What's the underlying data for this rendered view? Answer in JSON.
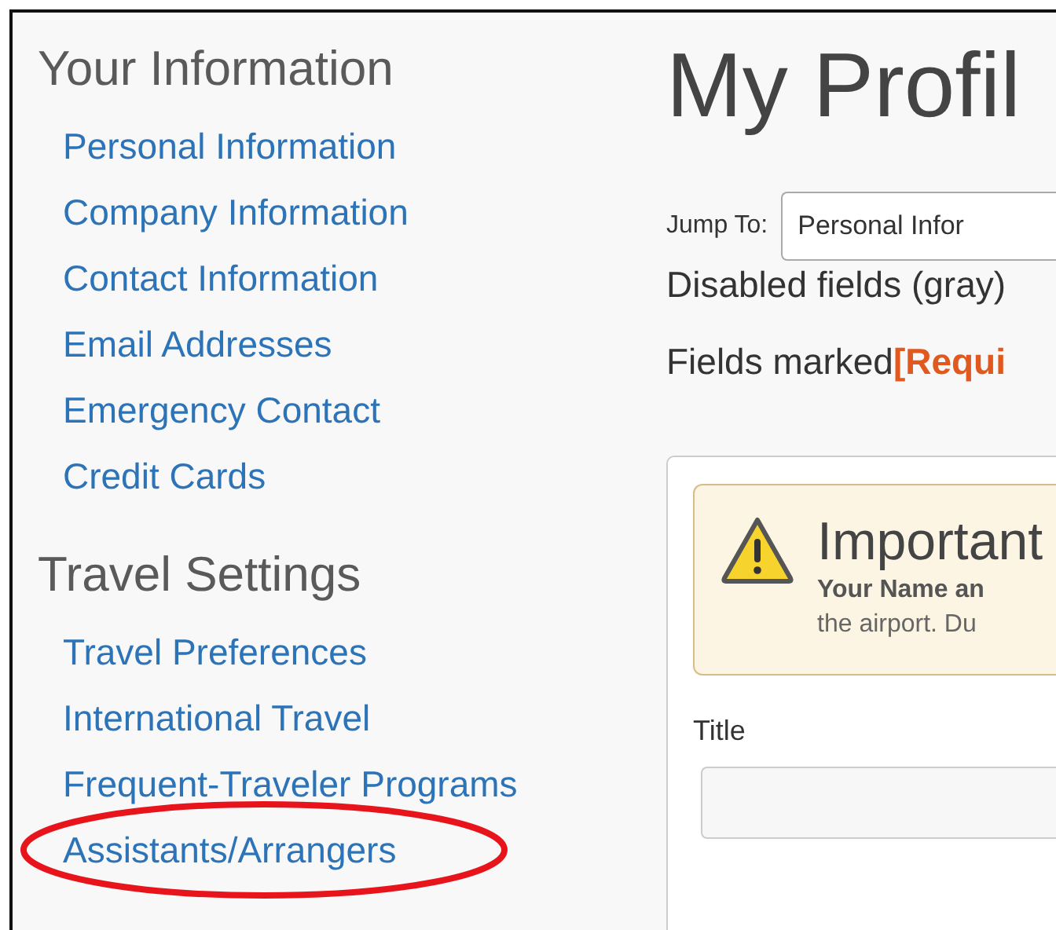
{
  "sidebar": {
    "sections": [
      {
        "heading": "Your Information",
        "items": [
          {
            "label": "Personal Information",
            "highlighted": false
          },
          {
            "label": "Company Information",
            "highlighted": false
          },
          {
            "label": "Contact Information",
            "highlighted": false
          },
          {
            "label": "Email Addresses",
            "highlighted": false
          },
          {
            "label": "Emergency Contact",
            "highlighted": false
          },
          {
            "label": "Credit Cards",
            "highlighted": false
          }
        ]
      },
      {
        "heading": "Travel Settings",
        "items": [
          {
            "label": "Travel Preferences",
            "highlighted": false
          },
          {
            "label": "International Travel",
            "highlighted": false
          },
          {
            "label": "Frequent-Traveler Programs",
            "highlighted": false
          },
          {
            "label": "Assistants/Arrangers",
            "highlighted": true
          }
        ]
      }
    ]
  },
  "main": {
    "title": "My Profil",
    "jump_to": {
      "label": "Jump To:",
      "value": "Personal Infor"
    },
    "disabled_note": "Disabled fields (gray)",
    "required_note": "Fields marked**[Requi**",
    "alert": {
      "title": "Important",
      "lines": [
        "Your Name an",
        "the airport. Du"
      ]
    },
    "fields": [
      {
        "label": "Title"
      }
    ]
  }
}
